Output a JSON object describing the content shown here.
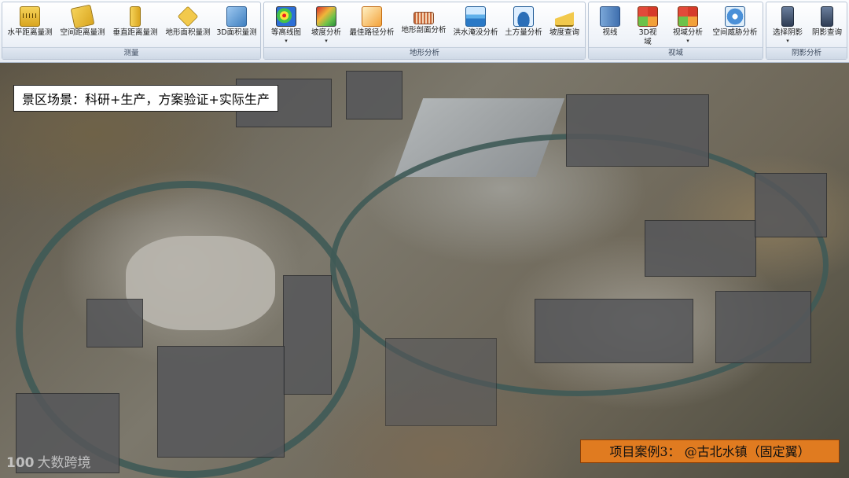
{
  "ribbon": {
    "groups": [
      {
        "label": "测量",
        "buttons": [
          {
            "label": "水平距离量测",
            "icon": "ruler-icon"
          },
          {
            "label": "空间距离量测",
            "icon": "ruler-diagonal-icon"
          },
          {
            "label": "垂直距离量测",
            "icon": "ruler-vertical-icon"
          },
          {
            "label": "地形面积量测",
            "icon": "area-measure-icon"
          },
          {
            "label": "3D面积量测",
            "icon": "cube-area-icon"
          }
        ]
      },
      {
        "label": "地形分析",
        "buttons": [
          {
            "label": "等高线图",
            "icon": "contour-icon"
          },
          {
            "label": "坡度分析",
            "icon": "slope-icon"
          },
          {
            "label": "最佳路径分析",
            "icon": "path-icon"
          },
          {
            "label": "地形剖面分析",
            "icon": "profile-icon"
          },
          {
            "label": "洪水淹没分析",
            "icon": "flood-icon"
          },
          {
            "label": "土方量分析",
            "icon": "earthwork-icon"
          },
          {
            "label": "坡度查询",
            "icon": "slope-query-icon"
          }
        ]
      },
      {
        "label": "视域",
        "buttons": [
          {
            "label": "视线",
            "icon": "sightline-icon"
          },
          {
            "label": "3D视域",
            "icon": "viewshed-3d-icon"
          },
          {
            "label": "视域分析",
            "icon": "viewshed-icon"
          },
          {
            "label": "空间威胁分析",
            "icon": "threat-icon"
          }
        ]
      },
      {
        "label": "阴影分析",
        "buttons": [
          {
            "label": "选择阴影",
            "icon": "shadow-select-icon"
          },
          {
            "label": "阴影查询",
            "icon": "shadow-query-icon"
          }
        ]
      }
    ]
  },
  "map": {
    "scene_label": "景区场景：科研+生产，方案验证+实际生产",
    "case_label": "项目案例3： @古北水镇（固定翼）",
    "watermark": "大数跨境",
    "watermark_logo": "100"
  }
}
